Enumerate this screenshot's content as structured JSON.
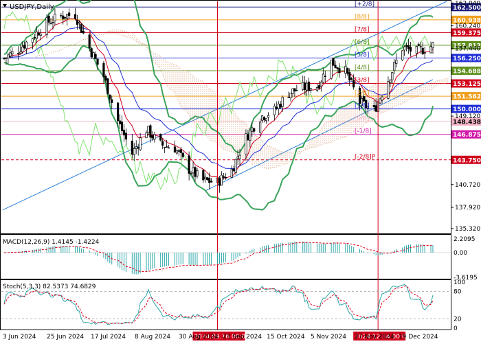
{
  "header": {
    "symbol_label": "USDJPY,Daily"
  },
  "colors": {
    "candle": "#000000",
    "bollinger": "#3aa35a",
    "envelope": "#7fe36e",
    "ema_fast": "#d0021b",
    "ema_slow": "#1f2fd6",
    "channel": "#2b7fd8",
    "ichimoku": "#d6a07a",
    "macd_hist": "#2aa5a8",
    "signal": "#e2001a",
    "stoch_main": "#2aa5a8",
    "stoch_signal": "#e2001a",
    "level_green": "#5f8f1c",
    "level_red": "#d0021b",
    "level_blue": "#1f2fd6",
    "level_orange": "#f0a020",
    "level_magenta": "#d21aa8"
  },
  "levels": [
    {
      "label": "[+2/8]",
      "value": 162.5,
      "price_text": "162.500",
      "badge": "#1a1a7a",
      "line": "#1a1a7a",
      "dash": false
    },
    {
      "label": "[8/8]",
      "value": 160.938,
      "price_text": "160.938",
      "badge": "#f0a020",
      "line": "#f0a020",
      "dash": false
    },
    {
      "label": "[7/8]",
      "value": 159.375,
      "price_text": "159.375",
      "badge": "#d0021b",
      "line": "#d0021b",
      "dash": false
    },
    {
      "label": "[6/8]",
      "value": 157.812,
      "price_text": "157.812",
      "badge": "#5f8f1c",
      "line": "#5f8f1c",
      "dash": false
    },
    {
      "label": "[5/8]",
      "value": 156.25,
      "price_text": "156.250",
      "badge": "#1f2fd6",
      "line": "#1f2fd6",
      "dash": false
    },
    {
      "label": "[4/8]",
      "value": 154.688,
      "price_text": "154.688",
      "badge": "#5f8f1c",
      "line": "#5f8f1c",
      "dash": false
    },
    {
      "label": "[3/8]",
      "value": 153.125,
      "price_text": "153.125",
      "badge": "#d0021b",
      "line": "#d0021b",
      "dash": false
    },
    {
      "label": "[2/8]",
      "value": 151.562,
      "price_text": "151.562",
      "badge": "#f0a020",
      "line": "#f0a020",
      "dash": false
    },
    {
      "label": "[1/8]",
      "value": 150.0,
      "price_text": "150.000",
      "badge": "#1f2fd6",
      "line": "#1f2fd6",
      "dash": false
    },
    {
      "label": "[0/8]",
      "value": 148.438,
      "price_text": "148.438",
      "badge": "#f4b6c8",
      "line": "#f4b6c8",
      "dash": false
    },
    {
      "label": "[-1/8]",
      "value": 146.875,
      "price_text": "146.875",
      "badge": "#d21aa8",
      "line": "#d21aa8",
      "dash": false
    },
    {
      "label": "[-2/8]P",
      "value": 143.75,
      "price_text": "143.750",
      "badge": "#d0021b",
      "line": "#d0021b",
      "dash": true
    }
  ],
  "price_axis": {
    "ticks": [
      {
        "text": "162.040",
        "value": 163.0
      },
      {
        "text": "160.240",
        "value": 160.2
      },
      {
        "text": "157.440",
        "value": 157.44
      },
      {
        "text": "149.120",
        "value": 149.12
      },
      {
        "text": "140.720",
        "value": 140.72
      },
      {
        "text": "137.920",
        "value": 137.92
      },
      {
        "text": "135.320",
        "value": 135.32
      }
    ],
    "min": 134.8,
    "max": 163.2
  },
  "time_axis": {
    "labels": [
      "3 Jun 2024",
      "25 Jun 2024",
      "17 Jul 2024",
      "8 Aug 2024",
      "30 Aug 2024",
      "23 Sep 2024",
      "15 Oct 2024",
      "5 Nov 2024",
      "27 Nov 2024",
      "19 Dec 2024"
    ],
    "markers": [
      {
        "label": "2024.09.16 00:00",
        "date": "2024-09-16"
      },
      {
        "label": "2024.12.04 00:00",
        "date": "2024-12-04"
      }
    ]
  },
  "macd_panel": {
    "label": "MACD(12,26,9) 1.4145 -1.4224",
    "tick_labels": [
      "2.2095",
      "0.00",
      "-3.6195"
    ],
    "max": 2.2095,
    "min": -3.6195
  },
  "stoch_panel": {
    "label": "Stoch(5,3,3) 82.5373 74.6829",
    "tick_labels": [
      "100",
      "80",
      "20",
      "0"
    ],
    "upper": 80,
    "lower": 20
  },
  "chart_data": {
    "type": "candlestick",
    "symbol": "USDJPY",
    "timeframe": "Daily",
    "x_range": [
      "2024-06-03",
      "2024-12-31"
    ],
    "y_range": [
      134.8,
      163.2
    ],
    "close_trace": [
      {
        "date": "2024-06-03",
        "close": 156.2
      },
      {
        "date": "2024-06-10",
        "close": 157.3
      },
      {
        "date": "2024-06-17",
        "close": 158.8
      },
      {
        "date": "2024-06-24",
        "close": 160.6
      },
      {
        "date": "2024-07-01",
        "close": 161.4
      },
      {
        "date": "2024-07-08",
        "close": 161.6
      },
      {
        "date": "2024-07-15",
        "close": 157.5
      },
      {
        "date": "2024-07-22",
        "close": 154.0
      },
      {
        "date": "2024-07-29",
        "close": 148.5
      },
      {
        "date": "2024-08-05",
        "close": 144.5
      },
      {
        "date": "2024-08-12",
        "close": 147.5
      },
      {
        "date": "2024-08-19",
        "close": 145.6
      },
      {
        "date": "2024-08-26",
        "close": 145.2
      },
      {
        "date": "2024-09-02",
        "close": 142.6
      },
      {
        "date": "2024-09-09",
        "close": 141.2
      },
      {
        "date": "2024-09-16",
        "close": 141.0
      },
      {
        "date": "2024-09-23",
        "close": 142.5
      },
      {
        "date": "2024-09-30",
        "close": 146.5
      },
      {
        "date": "2024-10-07",
        "close": 149.0
      },
      {
        "date": "2024-10-14",
        "close": 149.8
      },
      {
        "date": "2024-10-21",
        "close": 152.0
      },
      {
        "date": "2024-10-28",
        "close": 152.6
      },
      {
        "date": "2024-11-04",
        "close": 152.8
      },
      {
        "date": "2024-11-11",
        "close": 155.8
      },
      {
        "date": "2024-11-18",
        "close": 154.6
      },
      {
        "date": "2024-11-25",
        "close": 150.8
      },
      {
        "date": "2024-12-02",
        "close": 149.8
      },
      {
        "date": "2024-12-09",
        "close": 153.6
      },
      {
        "date": "2024-12-16",
        "close": 157.5
      },
      {
        "date": "2024-12-23",
        "close": 157.0
      },
      {
        "date": "2024-12-31",
        "close": 157.8
      }
    ],
    "last_price": 157.812,
    "macd": {
      "params": "12,26,9",
      "main": 1.4145,
      "signal": -1.4224
    },
    "stochastic": {
      "params": "5,3,3",
      "main": 82.5373,
      "signal": 74.6829,
      "levels": [
        20,
        80
      ]
    }
  }
}
